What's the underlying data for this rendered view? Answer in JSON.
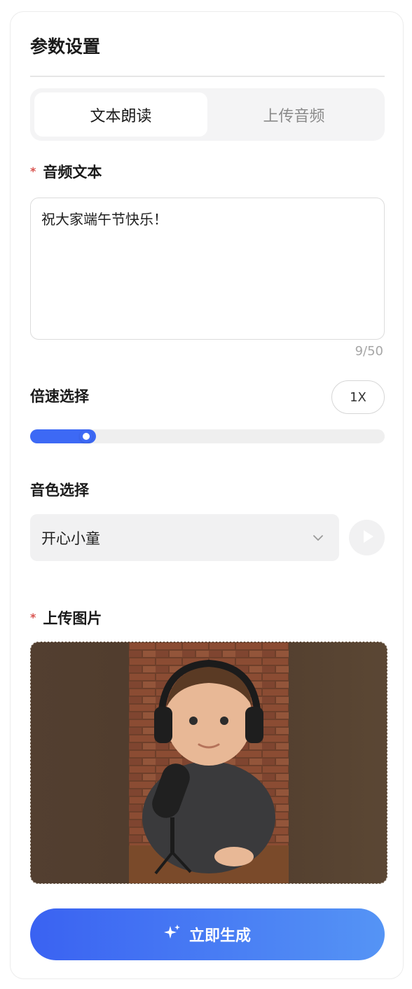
{
  "panel": {
    "title": "参数设置"
  },
  "tabs": [
    {
      "label": "文本朗读",
      "active": true
    },
    {
      "label": "上传音频",
      "active": false
    }
  ],
  "audio_text": {
    "label": "音频文本",
    "required_mark": "*",
    "value": "祝大家端午节快乐！",
    "counter": "9/50"
  },
  "speed": {
    "label": "倍速选择",
    "value_label": "1X",
    "slider_fraction": 0.17
  },
  "voice": {
    "label": "音色选择",
    "selected": "开心小童",
    "icons": {
      "dropdown": "chevron-down-icon",
      "preview": "play-icon"
    }
  },
  "image_upload": {
    "label": "上传图片",
    "required_mark": "*"
  },
  "generate": {
    "label": "立即生成",
    "icon": "sparkle-icon"
  },
  "colors": {
    "accent": "#3d69f5",
    "required": "#d9534f",
    "button_gradient_start": "#3a62f2",
    "button_gradient_end": "#5594f5"
  }
}
